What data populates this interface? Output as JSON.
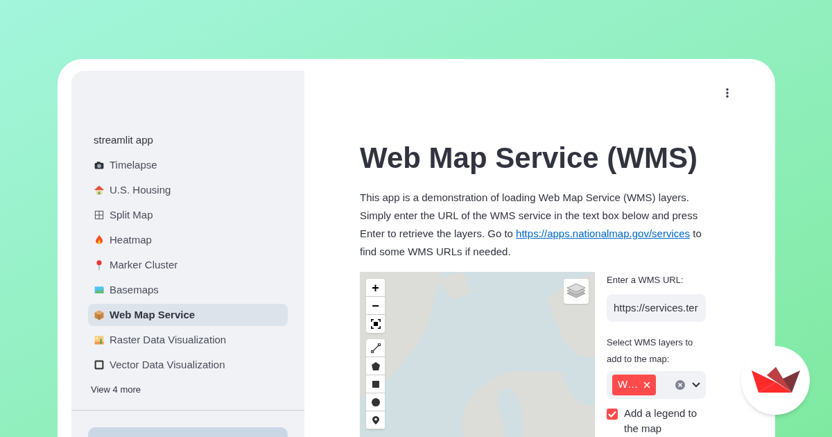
{
  "sidebar": {
    "app_name": "streamlit app",
    "items": [
      {
        "label": "Timelapse",
        "selected": false
      },
      {
        "label": "U.S. Housing",
        "selected": false
      },
      {
        "label": "Split Map",
        "selected": false
      },
      {
        "label": "Heatmap",
        "selected": false
      },
      {
        "label": "Marker Cluster",
        "selected": false
      },
      {
        "label": "Basemaps",
        "selected": false
      },
      {
        "label": "Web Map Service",
        "selected": true
      },
      {
        "label": "Raster Data Visualization",
        "selected": false
      },
      {
        "label": "Vector Data Visualization",
        "selected": false
      }
    ],
    "more_link": "View 4 more"
  },
  "main": {
    "title": "Web Map Service (WMS)",
    "description_before": "This app is a demonstration of loading Web Map Service (WMS) layers. Simply enter the URL of the WMS service in the text box below and press Enter to retrieve the layers. Go to ",
    "description_link": "https://apps.nationalmap.gov/services",
    "description_after": " to find some WMS URLs if needed.",
    "map": {
      "zoom_in": "+",
      "zoom_out": "−"
    },
    "url_field": {
      "label": "Enter a WMS URL:",
      "value": "https://services.ter"
    },
    "layers_select": {
      "label": "Select WMS layers to add to the map:",
      "tags": [
        "W…"
      ]
    },
    "legend_checkbox": {
      "label": "Add a legend to the map",
      "checked": true
    }
  }
}
